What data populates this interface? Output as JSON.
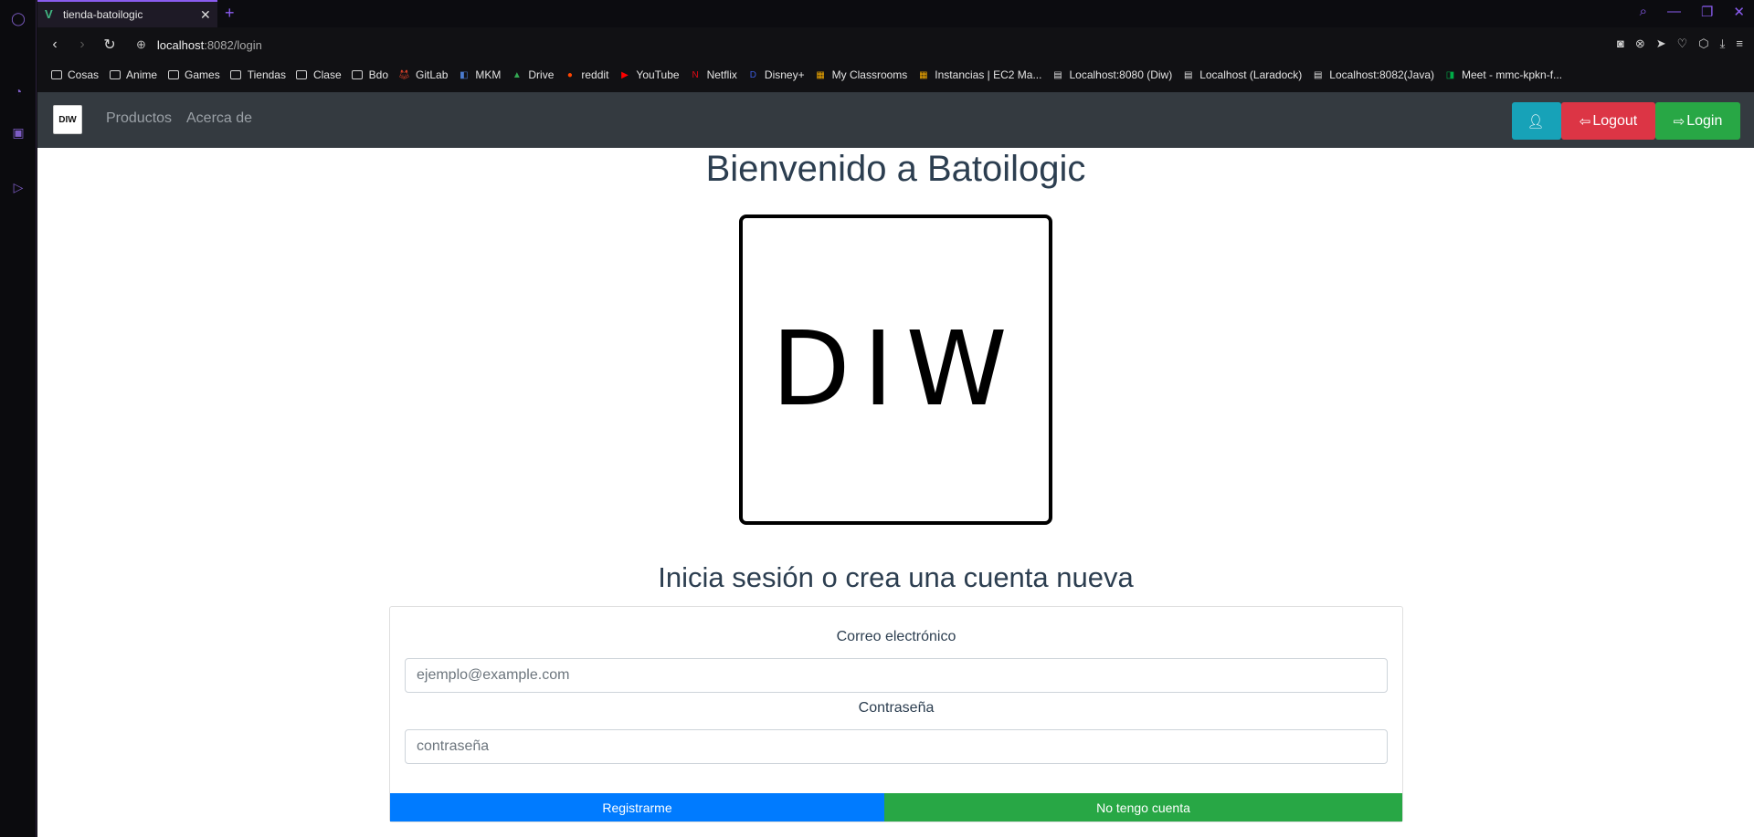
{
  "browser": {
    "tab_title": "tienda-batoilogic",
    "tab_close": "✕",
    "new_tab": "+",
    "url_host": "localhost",
    "url_path": ":8082/login",
    "bookmarks": [
      {
        "label": "Cosas",
        "icon": "folder-icon"
      },
      {
        "label": "Anime",
        "icon": "folder-icon"
      },
      {
        "label": "Games",
        "icon": "folder-icon"
      },
      {
        "label": "Tiendas",
        "icon": "folder-icon"
      },
      {
        "label": "Clase",
        "icon": "folder-icon"
      },
      {
        "label": "Bdo",
        "icon": "folder-icon"
      },
      {
        "label": "GitLab",
        "icon": "gitlab-icon"
      },
      {
        "label": "MKM",
        "icon": "mkm-icon"
      },
      {
        "label": "Drive",
        "icon": "drive-icon"
      },
      {
        "label": "reddit",
        "icon": "reddit-icon"
      },
      {
        "label": "YouTube",
        "icon": "youtube-icon"
      },
      {
        "label": "Netflix",
        "icon": "netflix-icon"
      },
      {
        "label": "Disney+",
        "icon": "disney-icon"
      },
      {
        "label": "My Classrooms",
        "icon": "box-icon"
      },
      {
        "label": "Instancias | EC2 Ma...",
        "icon": "box-icon"
      },
      {
        "label": "Localhost:8080 (Diw)",
        "icon": "page-icon"
      },
      {
        "label": "Localhost (Laradock)",
        "icon": "page-icon"
      },
      {
        "label": "Localhost:8082(Java)",
        "icon": "page-icon"
      },
      {
        "label": "Meet - mmc-kpkn-f...",
        "icon": "meet-icon"
      }
    ]
  },
  "navbar": {
    "brand": "DIW",
    "links": [
      "Productos",
      "Acerca de"
    ],
    "logout_label": "Logout",
    "login_label": "Login"
  },
  "main": {
    "welcome": "Bienvenido a Batoilogic",
    "logo_text": "DIW",
    "subtitle": "Inicia sesión o crea una cuenta nueva",
    "email_label": "Correo electrónico",
    "email_placeholder": "ejemplo@example.com",
    "password_label": "Contraseña",
    "password_placeholder": "contraseña",
    "register_label": "Registrarme",
    "no_account_label": "No tengo cuenta"
  },
  "colors": {
    "navbar_bg": "#343a40",
    "info": "#17a2b8",
    "danger": "#dc3545",
    "success": "#28a745",
    "primary": "#007bff",
    "browser_accent": "#8a5cf0"
  }
}
